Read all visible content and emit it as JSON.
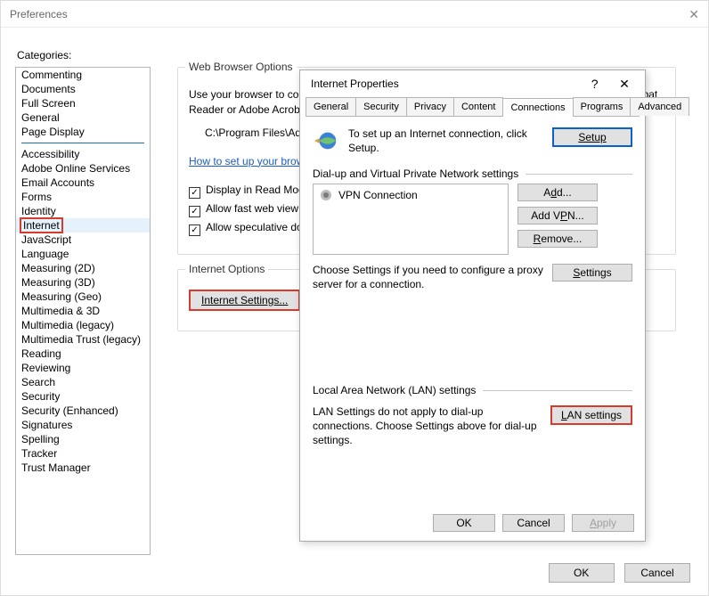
{
  "prefs": {
    "title": "Preferences",
    "categories_label": "Categories:",
    "categories_a": [
      "Commenting",
      "Documents",
      "Full Screen",
      "General",
      "Page Display"
    ],
    "categories_b": [
      "Accessibility",
      "Adobe Online Services",
      "Email Accounts",
      "Forms",
      "Identity",
      "Internet",
      "JavaScript",
      "Language",
      "Measuring (2D)",
      "Measuring (3D)",
      "Measuring (Geo)",
      "Multimedia & 3D",
      "Multimedia (legacy)",
      "Multimedia Trust (legacy)",
      "Reading",
      "Reviewing",
      "Search",
      "Security",
      "Security (Enhanced)",
      "Signatures",
      "Spelling",
      "Tracker",
      "Trust Manager"
    ],
    "selected_category": "Internet",
    "ok": "OK",
    "cancel": "Cancel"
  },
  "wbo": {
    "title": "Web Browser Options",
    "desc": "Use your browser to control viewing of PDF documents directly in the browser using Adobe Acrobat Reader or Adobe Acrobat...",
    "path": "C:\\Program Files\\Ado",
    "help_link": "How to set up your brow",
    "chk1": "Display in Read Mode",
    "chk2": "Allow fast web view",
    "chk3": "Allow speculative dow"
  },
  "io": {
    "title": "Internet Options",
    "button": "Internet Settings..."
  },
  "ip": {
    "title": "Internet Properties",
    "tabs": [
      "General",
      "Security",
      "Privacy",
      "Content",
      "Connections",
      "Programs",
      "Advanced"
    ],
    "active_tab": "Connections",
    "setup_text": "To set up an Internet connection, click Setup.",
    "setup_btn": "Setup",
    "dial_title": "Dial-up and Virtual Private Network settings",
    "vpn_item": "VPN Connection",
    "add_btn": "Add...",
    "addvpn_btn": "Add VPN...",
    "remove_btn": "Remove...",
    "settings_btn": "Settings",
    "proxy_text": "Choose Settings if you need to configure a proxy server for a connection.",
    "lan_title": "Local Area Network (LAN) settings",
    "lan_text": "LAN Settings do not apply to dial-up connections. Choose Settings above for dial-up settings.",
    "lan_btn": "LAN settings",
    "ok": "OK",
    "cancel": "Cancel",
    "apply": "Apply"
  }
}
